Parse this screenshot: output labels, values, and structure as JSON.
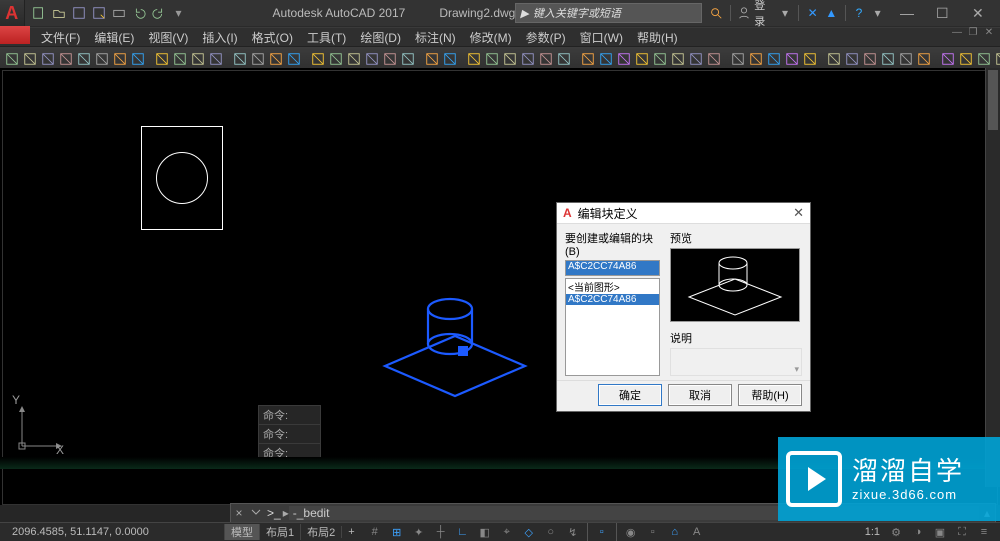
{
  "title": {
    "app": "Autodesk AutoCAD 2017",
    "file": "Drawing2.dwg",
    "search_placeholder": "键入关键字或短语",
    "login": "登录"
  },
  "menubar": {
    "items": [
      "文件(F)",
      "编辑(E)",
      "视图(V)",
      "插入(I)",
      "格式(O)",
      "工具(T)",
      "绘图(D)",
      "标注(N)",
      "修改(M)",
      "参数(P)",
      "窗口(W)",
      "帮助(H)"
    ]
  },
  "qat_icons": [
    "new-icon",
    "open-icon",
    "save-icon",
    "saveas-icon",
    "plot-icon",
    "undo-icon",
    "redo-icon"
  ],
  "toolbar_icons": [
    "new-icon",
    "open-icon",
    "save-icon",
    "print-icon",
    "cut-icon",
    "copy-icon",
    "paste-icon",
    "matchprop-icon",
    "sep",
    "block-icon",
    "table-icon",
    "hatch-icon",
    "region-icon",
    "sep",
    "layer-icon",
    "layer-state-icon",
    "layer-prev-icon",
    "layer-combo-icon",
    "sep",
    "dim-linear-icon",
    "dim-aligned-icon",
    "dim-angular-icon",
    "dim-radius-icon",
    "dim-diameter-icon",
    "dim-leader-icon",
    "sep",
    "text-icon",
    "mtext-icon",
    "sep",
    "line-icon",
    "polyline-icon",
    "circle-icon",
    "arc-icon",
    "rectangle-icon",
    "ellipse-icon",
    "sep",
    "move-icon",
    "copy2-icon",
    "rotate-icon",
    "trim-icon",
    "extend-icon",
    "mirror-icon",
    "offset-icon",
    "array-icon",
    "sep",
    "scale-icon",
    "stretch-icon",
    "fillet-icon",
    "chamfer-icon",
    "explode-icon",
    "sep",
    "ucs-icon",
    "view-icon",
    "pan-icon",
    "zoom-icon",
    "orbit-icon",
    "steering-icon",
    "sep",
    "render-icon",
    "materials-icon",
    "light-icon",
    "sun-icon",
    "sep",
    "measure-icon",
    "area-icon",
    "id-icon"
  ],
  "cmd_history": [
    "命令:",
    "命令:",
    "命令:"
  ],
  "commandline": {
    "prompt": ">_",
    "text": "-_bedit"
  },
  "status": {
    "coords": "2096.4585, 51.1147, 0.0000",
    "tabs": [
      "模型",
      "布局1",
      "布局2",
      "+"
    ],
    "active_tab": 0,
    "left_icons": [
      "model-btn",
      "grid-btn",
      "snap-btn",
      "dot-icon"
    ],
    "mid_icons": [
      "plus-icon",
      "ortho-icon",
      "polar-icon",
      "osnap-icon",
      "otrack-icon",
      "dynucs-icon",
      "dyninput-icon",
      "lineweight-icon",
      "transparency-icon",
      "cycling-icon",
      "sep",
      "3dosnap-icon",
      "sep",
      "workspace-icon",
      "annoscale-icon",
      "annovis-icon",
      "annoauto-icon"
    ],
    "right_text": "1:1",
    "right_icons": [
      "gear-icon",
      "isolate-icon",
      "hw-icon",
      "clean-icon",
      "customize-icon"
    ]
  },
  "dialog": {
    "title": "编辑块定义",
    "label_block": "要创建或编辑的块(B)",
    "input_value": "A$C2CC74A86",
    "list": [
      "<当前图形>",
      "A$C2CC74A86"
    ],
    "selected_index": 1,
    "label_preview": "预览",
    "label_desc": "说明",
    "buttons": {
      "ok": "确定",
      "cancel": "取消",
      "help": "帮助(H)"
    }
  },
  "watermark": {
    "line1": "溜溜自学",
    "line2": "zixue.3d66.com"
  },
  "ucs": {
    "x": "X",
    "y": "Y"
  }
}
